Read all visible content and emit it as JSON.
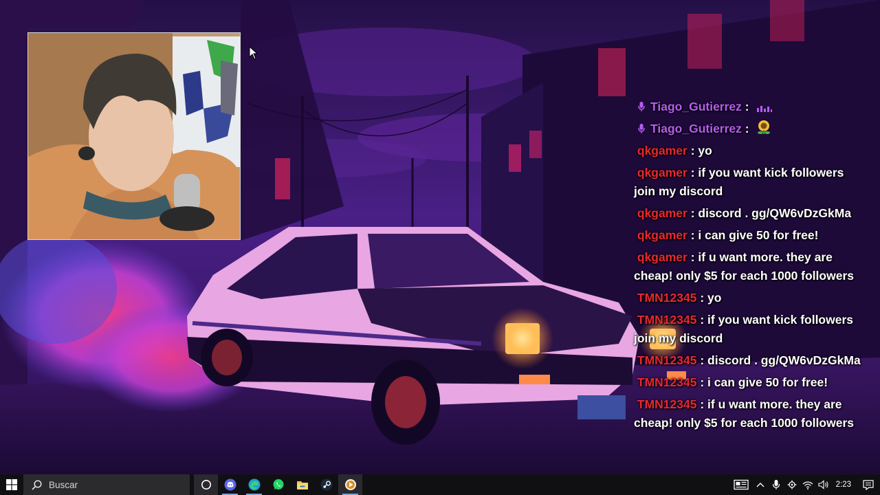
{
  "chat": {
    "messages": [
      {
        "user": "Tiago_Gutierrez",
        "color": "#b65cf0",
        "text": "",
        "mic": true,
        "emote": "bars-emote"
      },
      {
        "user": "Tiago_Gutierrez",
        "color": "#b65cf0",
        "text": "",
        "mic": true,
        "emote": "sunflower-emote"
      },
      {
        "user": "qkgamer",
        "color": "#e8282f",
        "text": "yo"
      },
      {
        "user": "qkgamer",
        "color": "#e8282f",
        "text": "if you want kick followers join my discord"
      },
      {
        "user": "qkgamer",
        "color": "#e8282f",
        "text": "discord . gg/QW6vDzGkMa"
      },
      {
        "user": "qkgamer",
        "color": "#e8282f",
        "text": "i can give 50 for free!"
      },
      {
        "user": "qkgamer",
        "color": "#e8282f",
        "text": "if u want more. they are cheap! only $5 for each 1000 followers"
      },
      {
        "user": "TMN12345",
        "color": "#e8282f",
        "text": "yo"
      },
      {
        "user": "TMN12345",
        "color": "#e8282f",
        "text": "if you want kick followers join my discord"
      },
      {
        "user": "TMN12345",
        "color": "#e8282f",
        "text": "discord . gg/QW6vDzGkMa"
      },
      {
        "user": "TMN12345",
        "color": "#e8282f",
        "text": "i can give 50 for free!"
      },
      {
        "user": "TMN12345",
        "color": "#e8282f",
        "text": "if u want more. they are cheap! only $5 for each 1000 followers"
      }
    ]
  },
  "taskbar": {
    "search_placeholder": "Buscar",
    "clock": "2:23",
    "apps": [
      {
        "name": "cortana-icon"
      },
      {
        "name": "discord-icon"
      },
      {
        "name": "edge-icon"
      },
      {
        "name": "whatsapp-icon"
      },
      {
        "name": "file-explorer-icon"
      },
      {
        "name": "steam-icon"
      },
      {
        "name": "media-player-icon"
      }
    ]
  },
  "colors": {
    "username_purple": "#b65cf0",
    "username_red": "#e8282f",
    "taskbar": "#101012"
  }
}
